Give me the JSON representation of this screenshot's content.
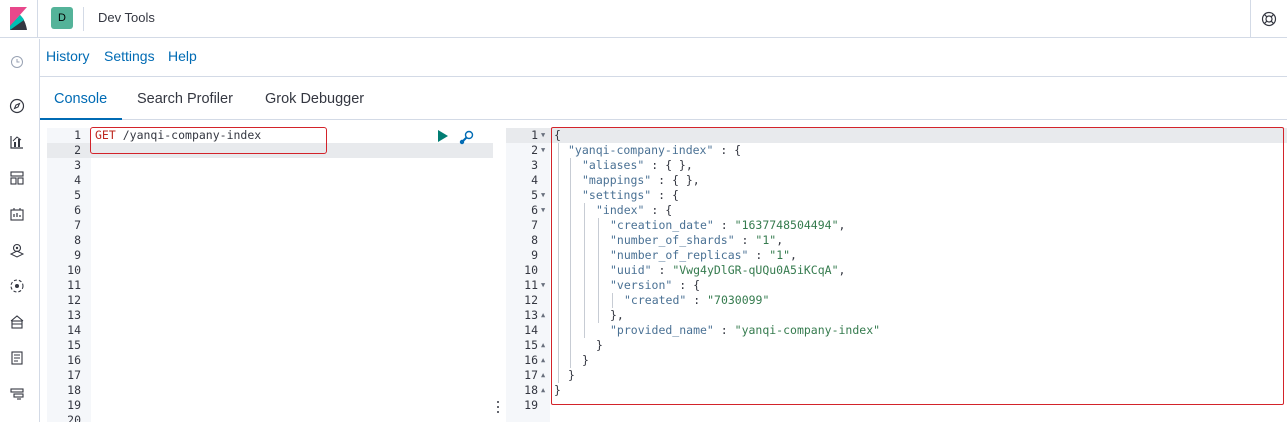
{
  "header": {
    "space_initial": "D",
    "app_title": "Dev Tools",
    "help_icon": "help-lifebuoy-icon",
    "brand_colors": {
      "pink": "#e8478b",
      "teal": "#00bfb3",
      "dark": "#343741"
    }
  },
  "sidenav": {
    "items": [
      "recently-viewed-icon",
      "discover-compass-icon",
      "visualize-icon",
      "dashboard-icon",
      "canvas-icon",
      "maps-icon",
      "ml-icon",
      "infrastructure-icon",
      "logs-icon",
      "apm-icon"
    ]
  },
  "menu": {
    "history": "History",
    "settings": "Settings",
    "help": "Help"
  },
  "tabs": [
    {
      "label": "Console",
      "active": true
    },
    {
      "label": "Search Profiler",
      "active": false
    },
    {
      "label": "Grok Debugger",
      "active": false
    }
  ],
  "request": {
    "method": "GET",
    "path": "/yanqi-company-index",
    "line_numbers": [
      "1",
      "2",
      "3",
      "4",
      "5",
      "6",
      "7",
      "8",
      "9",
      "10",
      "11",
      "12",
      "13",
      "14",
      "15",
      "16",
      "17",
      "18",
      "19",
      "20"
    ]
  },
  "response": {
    "line_numbers": [
      "1",
      "2",
      "3",
      "4",
      "5",
      "6",
      "7",
      "8",
      "9",
      "10",
      "11",
      "12",
      "13",
      "14",
      "15",
      "16",
      "17",
      "18",
      "19"
    ],
    "lines": [
      [
        [
          "{",
          "p"
        ]
      ],
      [
        [
          "\"yanqi-company-index\"",
          "k"
        ],
        [
          " : {",
          "p"
        ]
      ],
      [
        [
          "\"aliases\"",
          "k"
        ],
        [
          " : { },",
          "p"
        ]
      ],
      [
        [
          "\"mappings\"",
          "k"
        ],
        [
          " : { },",
          "p"
        ]
      ],
      [
        [
          "\"settings\"",
          "k"
        ],
        [
          " : {",
          "p"
        ]
      ],
      [
        [
          "\"index\"",
          "k"
        ],
        [
          " : {",
          "p"
        ]
      ],
      [
        [
          "\"creation_date\"",
          "k"
        ],
        [
          " : ",
          "p"
        ],
        [
          "\"1637748504494\"",
          "s"
        ],
        [
          ",",
          "p"
        ]
      ],
      [
        [
          "\"number_of_shards\"",
          "k"
        ],
        [
          " : ",
          "p"
        ],
        [
          "\"1\"",
          "s"
        ],
        [
          ",",
          "p"
        ]
      ],
      [
        [
          "\"number_of_replicas\"",
          "k"
        ],
        [
          " : ",
          "p"
        ],
        [
          "\"1\"",
          "s"
        ],
        [
          ",",
          "p"
        ]
      ],
      [
        [
          "\"uuid\"",
          "k"
        ],
        [
          " : ",
          "p"
        ],
        [
          "\"Vwg4yDlGR-qUQu0A5iKCqA\"",
          "s"
        ],
        [
          ",",
          "p"
        ]
      ],
      [
        [
          "\"version\"",
          "k"
        ],
        [
          " : {",
          "p"
        ]
      ],
      [
        [
          "\"created\"",
          "k"
        ],
        [
          " : ",
          "p"
        ],
        [
          "\"7030099\"",
          "s"
        ]
      ],
      [
        [
          "},",
          "p"
        ]
      ],
      [
        [
          "\"provided_name\"",
          "k"
        ],
        [
          " : ",
          "p"
        ],
        [
          "\"yanqi-company-index\"",
          "s"
        ]
      ],
      [
        [
          "}",
          "p"
        ]
      ],
      [
        [
          "}",
          "p"
        ]
      ],
      [
        [
          "}",
          "p"
        ]
      ],
      [
        [
          "}",
          "p"
        ]
      ],
      []
    ],
    "indent": [
      0,
      1,
      2,
      2,
      2,
      3,
      4,
      4,
      4,
      4,
      4,
      5,
      4,
      4,
      3,
      2,
      1,
      0,
      0
    ],
    "fold_markers": [
      "down",
      "down",
      "",
      "",
      "down",
      "down",
      "",
      "",
      "",
      "",
      "down",
      "",
      "up",
      "",
      "up",
      "up",
      "up",
      "up",
      ""
    ]
  }
}
